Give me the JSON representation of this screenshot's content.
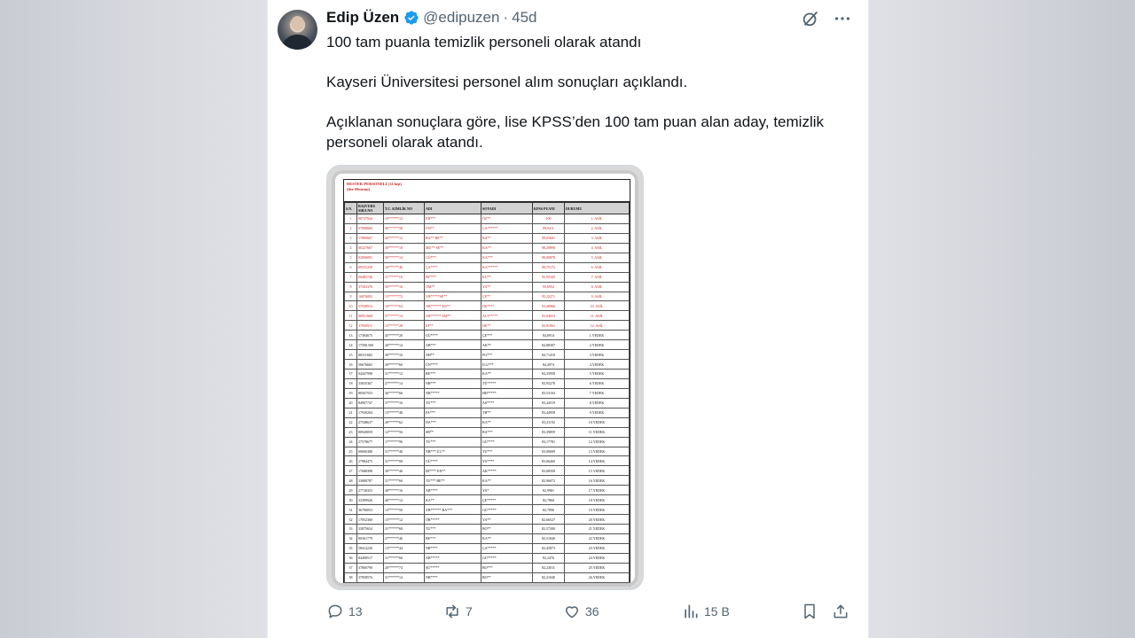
{
  "post": {
    "author_name": "Edip Üzen",
    "handle": "@edipuzen",
    "separator": "·",
    "age": "45d",
    "line1": "100 tam puanla temizlik personeli olarak atandı",
    "line2": "Kayseri Üniversitesi personel alım sonuçları açıklandı.",
    "line3": "Açıklanan sonuçlara göre, lise KPSS’den 100 tam puan alan aday, temizlik personeli olarak atandı."
  },
  "actions": {
    "replies": "13",
    "reposts": "7",
    "likes": "36",
    "views": "15 B"
  },
  "document": {
    "title_line1": "DESTEK PERSONELİ (12 kişi)",
    "title_line2": "(lise Mezunu)",
    "headers": [
      "S.N.",
      "BAŞVURU SIRA NO",
      "T.C. KİMLİK NO",
      "ADI",
      "SOYADI",
      "KPSS PUANI",
      "DURUMU"
    ],
    "rows": [
      [
        "1",
        "00727944",
        "10******12",
        "EB***",
        "ÖZ**",
        "100",
        "1. ASİL"
      ],
      [
        "2",
        "07098666",
        "40******58",
        "ÜN**",
        "ÇA******",
        "99,9411",
        "2. ASİL"
      ],
      [
        "3",
        "17890667",
        "20******12",
        "RA** BE**",
        "BA**",
        "99,03681",
        "3. ASİL"
      ],
      [
        "4",
        "00227667",
        "30******18",
        "MU** SE**",
        "KA**",
        "98,29898",
        "4. ASİL"
      ],
      [
        "5",
        "02096091",
        "50******14",
        "GÖ***",
        "KA***",
        "98,00878",
        "5. ASİL"
      ],
      [
        "6",
        "09531250",
        "10******46",
        "ÇA****",
        "KA******",
        "98,75172",
        "6. ASİL"
      ],
      [
        "7",
        "00485746",
        "11******16",
        "İR****",
        "KÜ**",
        "95,95165",
        "7. ASİL"
      ],
      [
        "8",
        "37503370",
        "50******16",
        "ÖM**",
        "YA**",
        "95,6952",
        "8. ASİL"
      ],
      [
        "9",
        "16876092",
        "13******72",
        "YB*****SE**",
        "ÇE**",
        "95,22271",
        "9. ASİL"
      ],
      [
        "10",
        "57938913",
        "10******64",
        "AB****** EN**",
        "DE****",
        "93,48966",
        "10. ASİL"
      ],
      [
        "11",
        "00951668",
        "37******14",
        "YB****** EM**",
        "ALT*****",
        "93,04653",
        "11. ASİL"
      ],
      [
        "12",
        "37950911",
        "13******28",
        "EF**",
        "DE**",
        "92,91961",
        "12. ASİL"
      ],
      [
        "13",
        "17384675",
        "45******20",
        "GÜ****",
        "ÇE***",
        "84,8914",
        "1.YEDEK"
      ],
      [
        "14",
        "17590.500",
        "20******14",
        "AB***",
        "AK**",
        "84,88307",
        "2.YEDEK"
      ],
      [
        "15",
        "00311682",
        "30******10",
        "NH**",
        "PO***",
        "84,71418",
        "3.YEDEK"
      ],
      [
        "16",
        "50676665",
        "29******60",
        "ÜN****",
        "ILG***",
        "84,4974",
        "4.YEDEK"
      ],
      [
        "17",
        "04447998",
        "31******12",
        "BE***",
        "KA**",
        "84,35958",
        "5.YEDEK"
      ],
      [
        "18",
        "33035367",
        "27******14",
        "NB***",
        "TÜ*****",
        "83,95278",
        "6.YEDEK"
      ],
      [
        "19",
        "80567553",
        "36******66",
        "NB*****",
        "HD*****",
        "83,53104",
        "7.YEDEK"
      ],
      [
        "20",
        "84907747",
        "37******16",
        "TU***",
        "AS****",
        "83,44519",
        "8.YEDEK"
      ],
      [
        "21",
        "17930204",
        "13******46",
        "FA***",
        "TH**",
        "83,44958",
        "9.YEDEK"
      ],
      [
        "22",
        "27548637",
        "20******62",
        "HA***",
        "KA**",
        "83,41192",
        "10.YEDEK"
      ],
      [
        "23",
        "80920059",
        "12******56",
        "SB**",
        "BA***",
        "83,39859",
        "11.YEDEK"
      ],
      [
        "24",
        "27578677",
        "17******96",
        "TU***",
        "GÜ****",
        "83,17781",
        "12.YEDEK"
      ],
      [
        "25",
        "00606380",
        "31******46",
        "NB*** ÜL**",
        "TU***",
        "83,00009",
        "13.YEDEK"
      ],
      [
        "26",
        "27984475",
        "31******00",
        "GÜ****",
        "YA****",
        "83,06460",
        "14.YEDEK"
      ],
      [
        "27",
        "17688398",
        "30******46",
        "İR**** EN**",
        "AK*****",
        "83,08358",
        "15.YEDEK"
      ],
      [
        "28",
        "33080787",
        "31******60",
        "TU*** BE**",
        "KA**",
        "82,96072",
        "16.YEDEK"
      ],
      [
        "29",
        "27728353",
        "30******16",
        "AB****",
        "YA*",
        "82,9981",
        "17.YEDEK"
      ],
      [
        "30",
        "33399926",
        "40******12",
        "KA**",
        "ÇE*****",
        "82,7860",
        "18.YEDEK"
      ],
      [
        "31",
        "36790053",
        "13******50",
        "YB****** BA***",
        "GÜ*****",
        "82,7096",
        "19.YEDEK"
      ],
      [
        "32",
        "17052360",
        "13******12",
        "ÖR*****",
        "YA**",
        "82,66527",
        "20.YEDEK"
      ],
      [
        "33",
        "33875654",
        "31******60",
        "TU***",
        "BO**",
        "82,57300",
        "21.YEDEK"
      ],
      [
        "34",
        "80361779",
        "37******46",
        "BE***",
        "KA**",
        "82,51840",
        "22.YEDEK"
      ],
      [
        "35",
        "58412236",
        "13******44",
        "NB****",
        "ÇA*****",
        "82,45873",
        "23.YEDEK"
      ],
      [
        "36",
        "84490517",
        "31******66",
        "AB*****",
        "GÜ*****",
        "82,2476",
        "24.YEDEK"
      ],
      [
        "37",
        "37860790",
        "20******74",
        "ŞÜ*****",
        "BO***",
        "82,23011",
        "25.YEDEK"
      ],
      [
        "38",
        "37958576",
        "31******14",
        "NB****",
        "BO**",
        "82,21040",
        "26.YEDEK"
      ],
      [
        "39",
        "80463527",
        "21******50",
        "NB****** ME****",
        "TU**",
        "82,14474",
        "27.YEDEK"
      ]
    ]
  },
  "colors": {
    "accent": "#1d9bf0",
    "text": "#0f1419",
    "muted": "#536471",
    "doc_red": "#d01a1a"
  },
  "icons": {
    "verified": "verified-badge-icon",
    "grok": "grok-icon",
    "more": "more-icon",
    "reply": "reply-icon",
    "repost": "repost-icon",
    "like": "heart-icon",
    "views": "views-icon",
    "bookmark": "bookmark-icon",
    "share": "share-icon"
  }
}
